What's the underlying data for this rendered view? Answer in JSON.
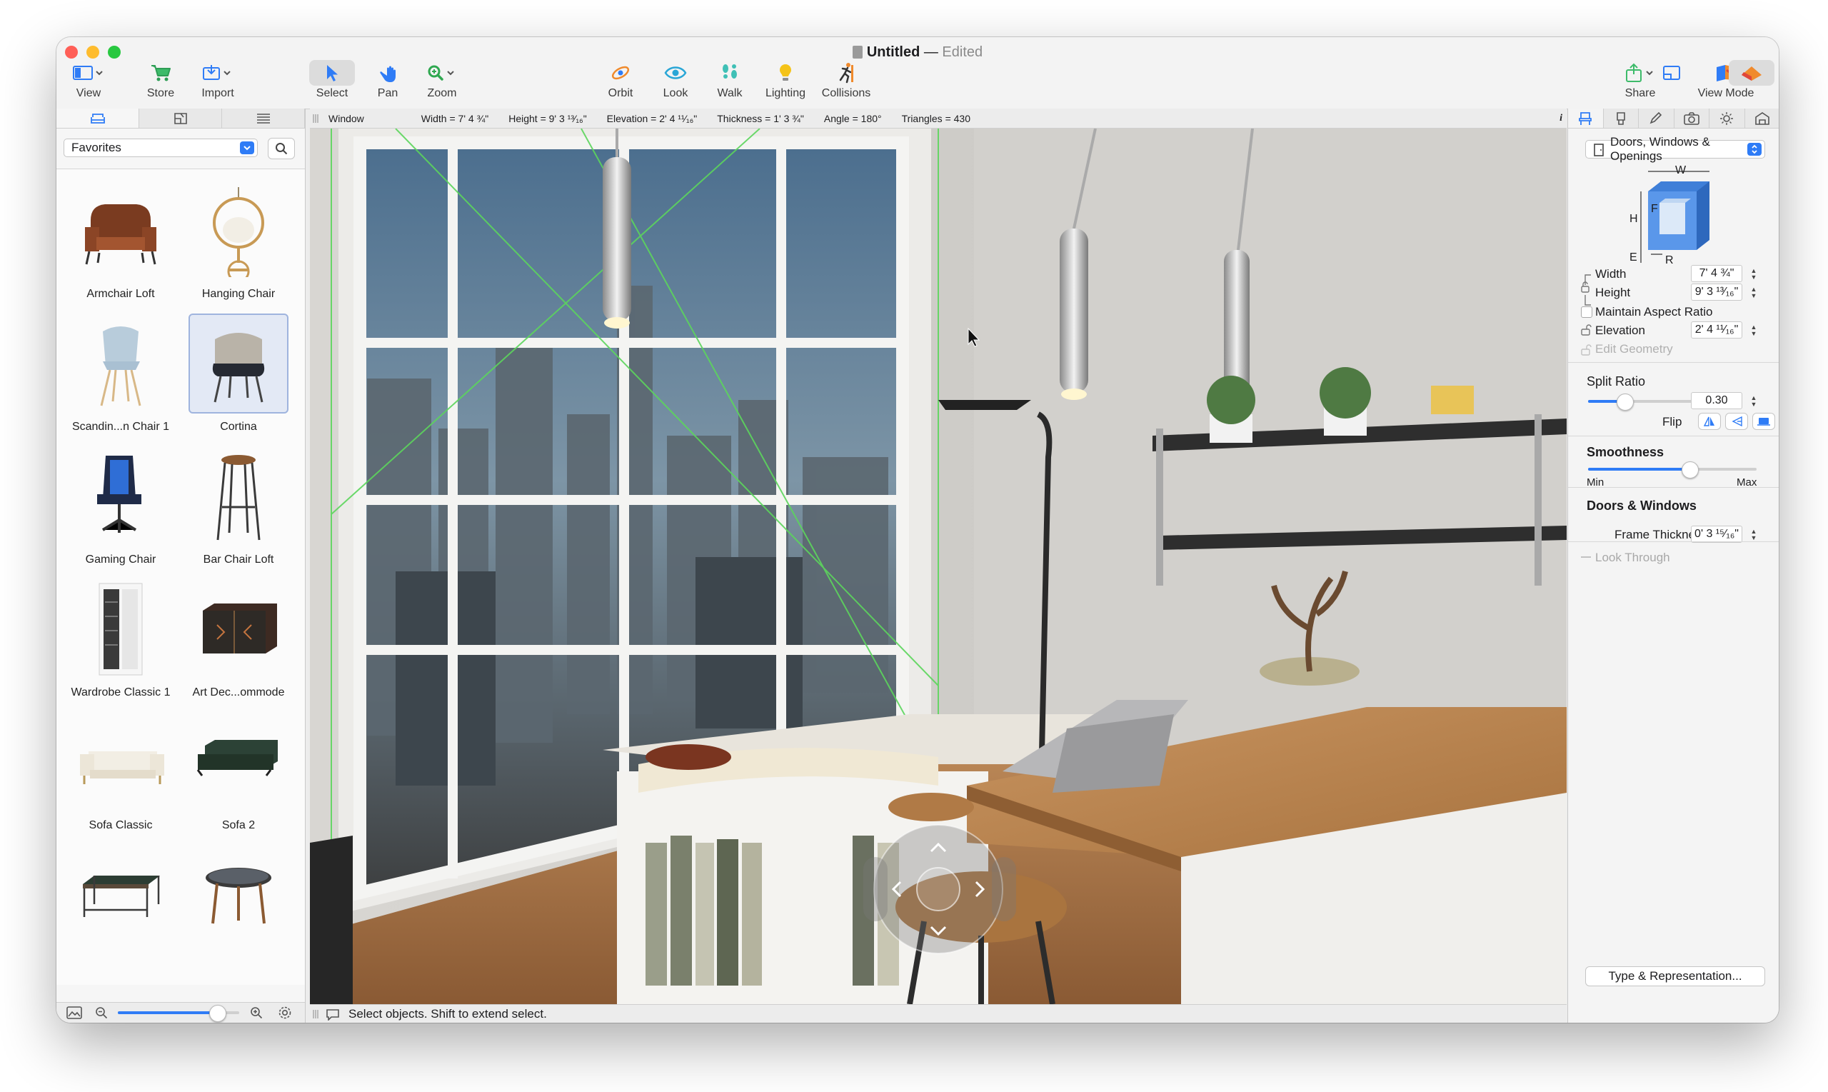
{
  "window": {
    "doc_title": "Untitled",
    "separator": "—",
    "status": "Edited"
  },
  "toolbar": {
    "view": "View",
    "store": "Store",
    "import": "Import",
    "select": "Select",
    "pan": "Pan",
    "zoom": "Zoom",
    "orbit": "Orbit",
    "look": "Look",
    "walk": "Walk",
    "lighting": "Lighting",
    "collisions": "Collisions",
    "share": "Share",
    "view_mode": "View Mode"
  },
  "infobar": {
    "object": "Window",
    "width": "Width = 7' 4 ¾\"",
    "height": "Height = 9' 3 ¹³⁄₁₆\"",
    "elevation": "Elevation = 2' 4 ¹¹⁄₁₆\"",
    "thickness": "Thickness = 1' 3 ¾\"",
    "angle": "Angle = 180°",
    "triangles": "Triangles = 430",
    "info_glyph": "i"
  },
  "library": {
    "category": "Favorites",
    "items": [
      {
        "name": "Armchair Loft"
      },
      {
        "name": "Hanging Chair"
      },
      {
        "name": "Scandin...n Chair 1"
      },
      {
        "name": "Cortina"
      },
      {
        "name": "Gaming Chair"
      },
      {
        "name": "Bar Chair Loft"
      },
      {
        "name": "Wardrobe Classic 1"
      },
      {
        "name": "Art Dec...ommode"
      },
      {
        "name": "Sofa Classic"
      },
      {
        "name": "Sofa 2"
      }
    ],
    "zoom_slider_level": 0.82
  },
  "status": {
    "message": "Select objects. Shift to extend select."
  },
  "inspector": {
    "category": "Doors, Windows & Openings",
    "diagram": {
      "w": "W",
      "h": "H",
      "f": "F",
      "e": "E",
      "r": "R"
    },
    "width_label": "Width",
    "width_value": "7' 4 ¾\"",
    "height_label": "Height",
    "height_value": "9' 3 ¹³⁄₁₆\"",
    "maintain_aspect": "Maintain Aspect Ratio",
    "elevation_label": "Elevation",
    "elevation_value": "2' 4 ¹¹⁄₁₆\"",
    "edit_geometry": "Edit Geometry",
    "split_ratio_title": "Split Ratio",
    "split_ratio_value": "0.30",
    "flip_label": "Flip",
    "smoothness_title": "Smoothness",
    "smoothness_min": "Min",
    "smoothness_max": "Max",
    "smoothness_level": 0.6,
    "doors_windows_title": "Doors & Windows",
    "frame_thickness_label": "Frame Thickness",
    "frame_thickness_value": "0' 3 ¹⁵⁄₁₆\"",
    "look_through": "Look Through",
    "type_button": "Type & Representation..."
  },
  "colors": {
    "accent": "#2f7cf6",
    "close": "#ff5f57",
    "minimize": "#febc2e",
    "zoom": "#28c840"
  }
}
